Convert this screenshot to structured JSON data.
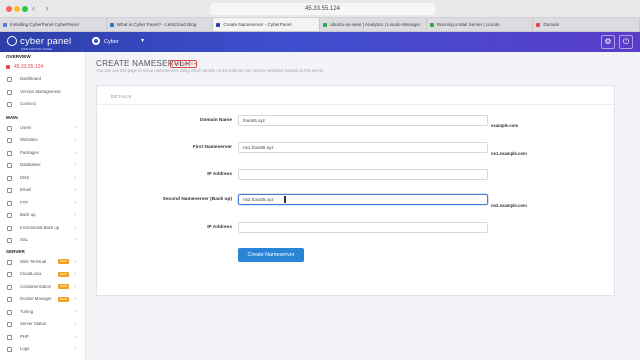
{
  "browser": {
    "address": "45.33.55.124",
    "tabs": [
      {
        "label": "Installing CyberPanel CyberPanel",
        "color": "#4a7bd8",
        "active": false
      },
      {
        "label": "What is Cyber Panel? - LetsCloud Blog",
        "color": "#3b6ed4",
        "active": false
      },
      {
        "label": "Create Nameserver - CyberPanel",
        "color": "#2c3fa8",
        "active": true
      },
      {
        "label": "ubuntu-us-west | Analytics | Linode Manager",
        "color": "#2aa84a",
        "active": false
      },
      {
        "label": "Running a Mail Server | Linode",
        "color": "#2aa84a",
        "active": false
      },
      {
        "label": "Domain",
        "color": "#e04848",
        "active": false
      }
    ]
  },
  "app": {
    "logo": "cyber panel",
    "logo_sub": "WEB HOSTING PANEL",
    "user": "Cyber"
  },
  "sidebar": {
    "overview_heading": "OVERVIEW",
    "ip": "45.33.55.124",
    "overview_items": [
      {
        "label": "Dashboard",
        "icon": "dashboard-icon"
      },
      {
        "label": "Version Management",
        "icon": "version-icon"
      },
      {
        "label": "Connect",
        "icon": "connect-icon"
      }
    ],
    "main_heading": "MAIN",
    "main_items": [
      {
        "label": "Users",
        "icon": "users-icon"
      },
      {
        "label": "Websites",
        "icon": "websites-icon"
      },
      {
        "label": "Packages",
        "icon": "packages-icon"
      },
      {
        "label": "Databases",
        "icon": "databases-icon"
      },
      {
        "label": "DNS",
        "icon": "dns-icon"
      },
      {
        "label": "Email",
        "icon": "email-icon"
      },
      {
        "label": "FTP",
        "icon": "ftp-icon"
      },
      {
        "label": "Back up",
        "icon": "backup-icon"
      },
      {
        "label": "Incremental Back up",
        "icon": "incremental-backup-icon"
      },
      {
        "label": "SSL",
        "icon": "ssl-icon"
      }
    ],
    "server_heading": "SERVER",
    "server_items": [
      {
        "label": "Web Terminal",
        "icon": "terminal-icon",
        "badge": "NEW"
      },
      {
        "label": "CloudLinux",
        "icon": "cloudlinux-icon",
        "badge": "NEW"
      },
      {
        "label": "Containerization",
        "icon": "container-icon",
        "badge": "NEW"
      },
      {
        "label": "Docker Manager",
        "icon": "docker-icon",
        "badge": "NEW"
      },
      {
        "label": "Tuning",
        "icon": "tuning-icon"
      },
      {
        "label": "Server Status",
        "icon": "server-status-icon"
      },
      {
        "label": "PHP",
        "icon": "php-icon"
      },
      {
        "label": "Logs",
        "icon": "logs-icon"
      }
    ]
  },
  "page": {
    "title": "CREATE NAMESERVER -",
    "docs_badge": "DNS DOCS",
    "subtitle": "You can use this page to setup nameservers using which people on the Internet can resolve websites hosted on this server.",
    "card_heading": "DETAILS"
  },
  "form": {
    "domain_label": "Domain Name",
    "domain_value": "foxo55.xyz",
    "domain_hint": "example.com",
    "first_ns_label": "First Nameserver",
    "first_ns_value": "ns1.foxo55.xyz",
    "first_ns_hint": "ns1.example.com",
    "ip1_label": "IP Address",
    "ip1_value": "",
    "second_ns_label": "Second Nameserver (Back up)",
    "second_ns_value": "ns2.foxo55.xyz",
    "second_ns_hint": "ns2.example.com",
    "ip2_label": "IP Address",
    "ip2_value": "",
    "submit_label": "Create Nameserver"
  }
}
